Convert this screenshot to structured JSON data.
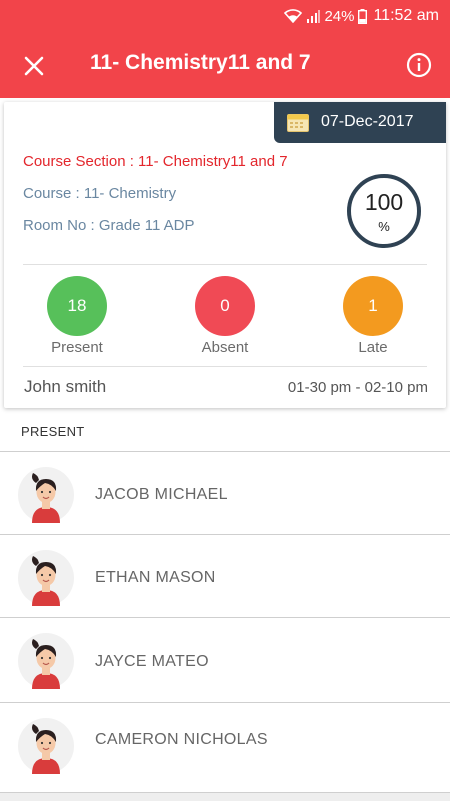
{
  "status_bar": {
    "battery": "24%",
    "time": "11:52 am"
  },
  "app_bar": {
    "title": "11- Chemistry11 and 7"
  },
  "card": {
    "date": "07-Dec-2017",
    "course_section": "Course Section : 11- Chemistry11 and 7",
    "course": "Course : 11- Chemistry",
    "room": "Room No : Grade 11 ADP",
    "attendance_percent": "100",
    "percent_unit": "%",
    "stats": [
      {
        "value": "18",
        "label": "Present",
        "color": "#57c05a"
      },
      {
        "value": "0",
        "label": "Absent",
        "color": "#f04a55"
      },
      {
        "value": "1",
        "label": "Late",
        "color": "#f39a1f"
      }
    ],
    "teacher": "John smith",
    "time_range": "01-30 pm - 02-10 pm"
  },
  "present_section": {
    "header": "PRESENT",
    "students": [
      {
        "name": "JACOB MICHAEL"
      },
      {
        "name": "ETHAN MASON"
      },
      {
        "name": "JAYCE MATEO"
      },
      {
        "name": "CAMERON NICHOLAS"
      }
    ]
  },
  "colors": {
    "primary": "#f2444a",
    "dark_accent": "#2f4253",
    "present": "#57c05a",
    "absent": "#f04a55",
    "late": "#f39a1f"
  }
}
